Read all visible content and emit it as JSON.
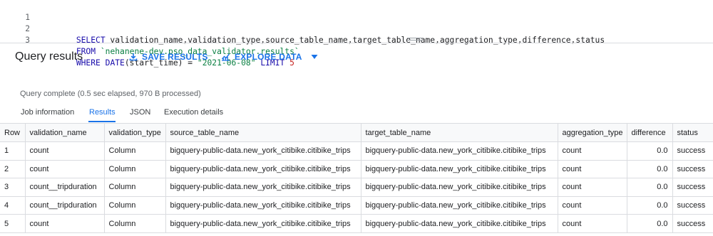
{
  "editor": {
    "lines": [
      {
        "n": "1",
        "segs": [
          {
            "t": "SELECT",
            "c": "kw"
          },
          {
            "t": " validation_name,validation_type,source_table_name,target_table_name,aggregation_type,difference,status",
            "c": "plain"
          }
        ]
      },
      {
        "n": "2",
        "segs": [
          {
            "t": "FROM",
            "c": "kw"
          },
          {
            "t": " ",
            "c": "plain"
          },
          {
            "t": "`nehanene-dev.pso_data_validator.results`",
            "c": "str"
          }
        ]
      },
      {
        "n": "3",
        "segs": [
          {
            "t": "WHERE",
            "c": "kw"
          },
          {
            "t": " ",
            "c": "plain"
          },
          {
            "t": "DATE",
            "c": "kw"
          },
          {
            "t": "(start_time) = ",
            "c": "plain"
          },
          {
            "t": "\"2021-06-08\"",
            "c": "str"
          },
          {
            "t": " ",
            "c": "plain"
          },
          {
            "t": "LIMIT",
            "c": "kw"
          },
          {
            "t": " ",
            "c": "plain"
          },
          {
            "t": "5",
            "c": "num"
          }
        ]
      }
    ]
  },
  "results_header": {
    "title": "Query results",
    "save_label": "SAVE RESULTS",
    "explore_label": "EXPLORE DATA"
  },
  "status_text": "Query complete (0.5 sec elapsed, 970 B processed)",
  "tabs": [
    {
      "label": "Job information",
      "active": false
    },
    {
      "label": "Results",
      "active": true
    },
    {
      "label": "JSON",
      "active": false
    },
    {
      "label": "Execution details",
      "active": false
    }
  ],
  "table": {
    "columns": [
      "Row",
      "validation_name",
      "validation_type",
      "source_table_name",
      "target_table_name",
      "aggregation_type",
      "difference",
      "status"
    ],
    "rows": [
      [
        "1",
        "count",
        "Column",
        "bigquery-public-data.new_york_citibike.citibike_trips",
        "bigquery-public-data.new_york_citibike.citibike_trips",
        "count",
        "0.0",
        "success"
      ],
      [
        "2",
        "count",
        "Column",
        "bigquery-public-data.new_york_citibike.citibike_trips",
        "bigquery-public-data.new_york_citibike.citibike_trips",
        "count",
        "0.0",
        "success"
      ],
      [
        "3",
        "count__tripduration",
        "Column",
        "bigquery-public-data.new_york_citibike.citibike_trips",
        "bigquery-public-data.new_york_citibike.citibike_trips",
        "count",
        "0.0",
        "success"
      ],
      [
        "4",
        "count__tripduration",
        "Column",
        "bigquery-public-data.new_york_citibike.citibike_trips",
        "bigquery-public-data.new_york_citibike.citibike_trips",
        "count",
        "0.0",
        "success"
      ],
      [
        "5",
        "count",
        "Column",
        "bigquery-public-data.new_york_citibike.citibike_trips",
        "bigquery-public-data.new_york_citibike.citibike_trips",
        "count",
        "0.0",
        "success"
      ]
    ]
  },
  "colors": {
    "accent": "#1a73e8",
    "keyword": "#1a0dab",
    "string": "#0b8043",
    "number": "#c5221f"
  },
  "icons": {
    "save": "download-icon",
    "explore": "bar-chart-icon",
    "explore_menu": "caret-down-icon"
  }
}
